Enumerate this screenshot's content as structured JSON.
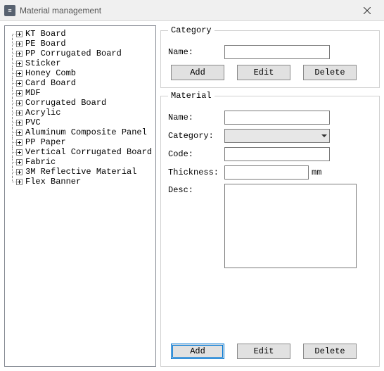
{
  "window": {
    "title": "Material management",
    "close_tooltip": "Close"
  },
  "tree": {
    "items": [
      "KT Board",
      "PE Board",
      "PP Corrugated Board",
      "Sticker",
      "Honey Comb",
      "Card Board",
      "MDF",
      "Corrugated Board",
      "Acrylic",
      "PVC",
      "Aluminum Composite Panel",
      "PP Paper",
      "Vertical Corrugated Board",
      "Fabric",
      "3M Reflective Material",
      "Flex Banner"
    ]
  },
  "category": {
    "legend": "Category",
    "name_label": "Name:",
    "name_value": "",
    "add": "Add",
    "edit": "Edit",
    "delete": "Delete"
  },
  "material": {
    "legend": "Material",
    "name_label": "Name:",
    "name_value": "",
    "category_label": "Category:",
    "category_value": "",
    "code_label": "Code:",
    "code_value": "",
    "thickness_label": "Thickness:",
    "thickness_value": "",
    "thickness_unit": "mm",
    "desc_label": "Desc:",
    "desc_value": "",
    "add": "Add",
    "edit": "Edit",
    "delete": "Delete"
  }
}
